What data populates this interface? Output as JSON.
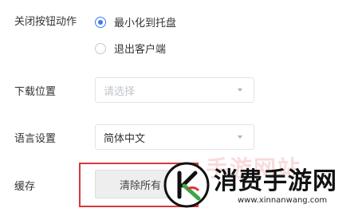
{
  "settings": {
    "close_action": {
      "label": "关闭按钮动作",
      "options": [
        {
          "label": "最小化到托盘",
          "checked": true
        },
        {
          "label": "退出客户端",
          "checked": false
        }
      ]
    },
    "download_location": {
      "label": "下载位置",
      "placeholder": "请选择"
    },
    "language": {
      "label": "语言设置",
      "value": "简体中文"
    },
    "cache": {
      "label": "缓存",
      "clear_button": "清除所有"
    }
  },
  "watermark": {
    "title": "消费手游网",
    "url": "www.xinnanwang.com",
    "accent_color": "#d9363e"
  },
  "colors": {
    "radio_active": "#3b7cf0",
    "highlight_border": "#d9363e"
  }
}
